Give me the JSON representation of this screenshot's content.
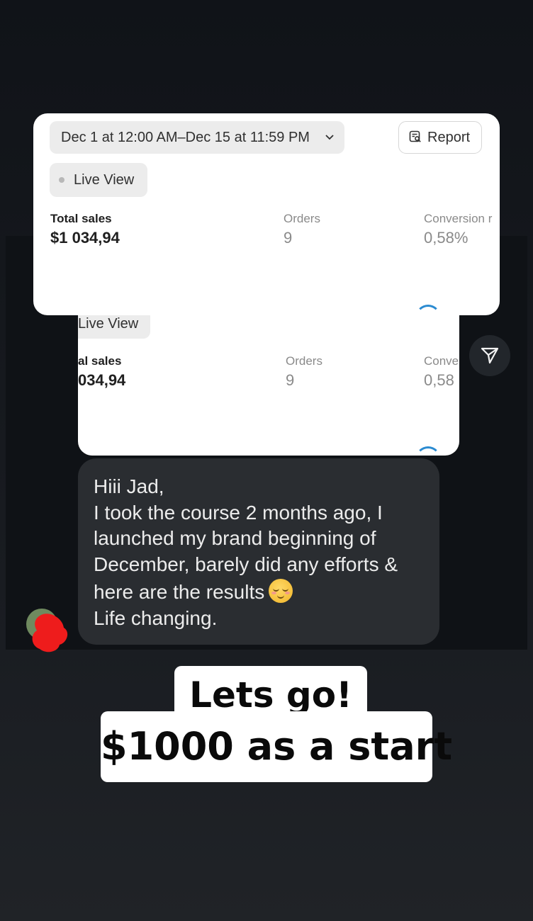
{
  "dashboard_front": {
    "date_range": "Dec 1 at 12:00 AM–Dec 15 at 11:59 PM",
    "report_label": "Report",
    "live_view_label": "Live View",
    "metrics": {
      "total_sales_label": "Total sales",
      "total_sales_value": "$1 034,94",
      "orders_label": "Orders",
      "orders_value": "9",
      "conversion_label": "Conversion r",
      "conversion_value": "0,58%"
    }
  },
  "dashboard_back": {
    "live_view_label": "Live View",
    "total_sales_label": "al sales",
    "total_sales_value": "034,94",
    "orders_label": "Orders",
    "orders_value": "9",
    "conversion_label": "Conve",
    "conversion_value": "0,58"
  },
  "message": {
    "lines": [
      "Hiii Jad,",
      "I took the course 2 months ago, I",
      "launched my brand beginning of",
      "December, barely did any efforts &",
      "here are the results",
      "Life changing."
    ]
  },
  "caption": {
    "line1": "Lets go!",
    "line2": "$1000 as a start"
  },
  "icons": {
    "report": "report-icon",
    "send": "send-icon",
    "chevron": "chevron-down-icon",
    "emoji": "relieved-face-emoji"
  }
}
